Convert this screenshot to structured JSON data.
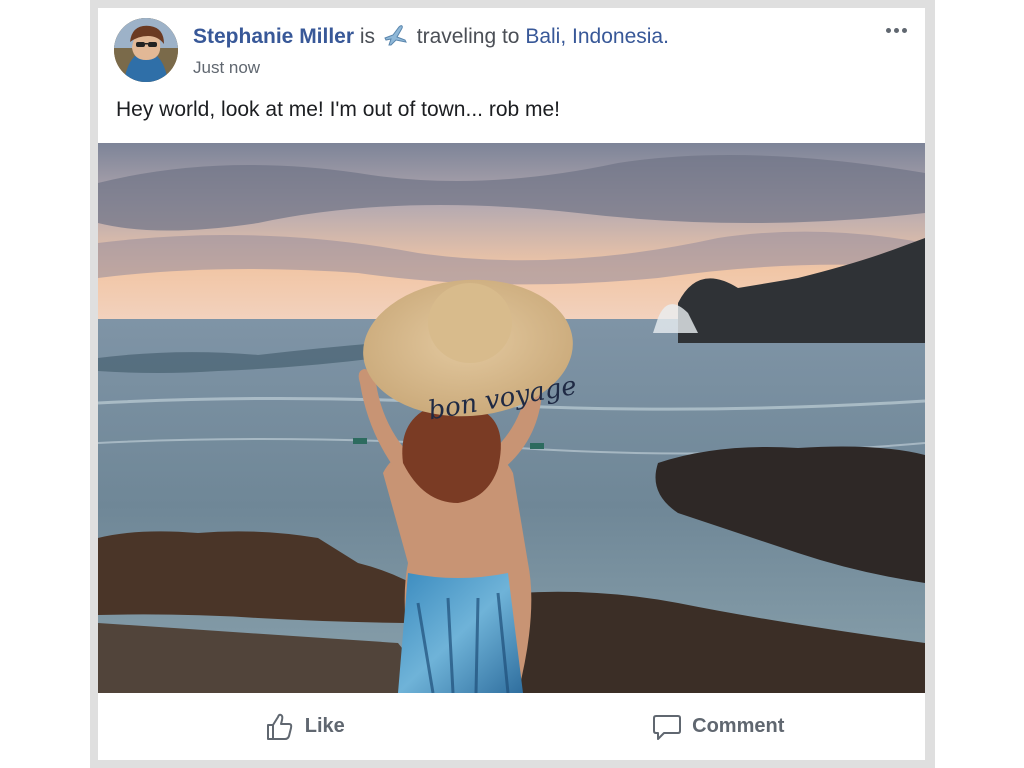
{
  "post": {
    "author": "Stephanie Miller",
    "verb": "is",
    "activity": "traveling to",
    "place": "Bali, Indonesia.",
    "timestamp": "Just now",
    "text": "Hey world, look at me! I'm out of town... rob me!",
    "photo_hat_text": "bon voyage"
  },
  "actions": {
    "like_label": "Like",
    "comment_label": "Comment"
  },
  "icons": {
    "activity": "airplane-icon",
    "menu": "more-options-icon",
    "like": "thumbs-up-icon",
    "comment": "speech-bubble-icon"
  },
  "colors": {
    "link": "#385898",
    "text": "#1c1e21",
    "secondary": "#606770",
    "frame": "#dfdfdf"
  }
}
